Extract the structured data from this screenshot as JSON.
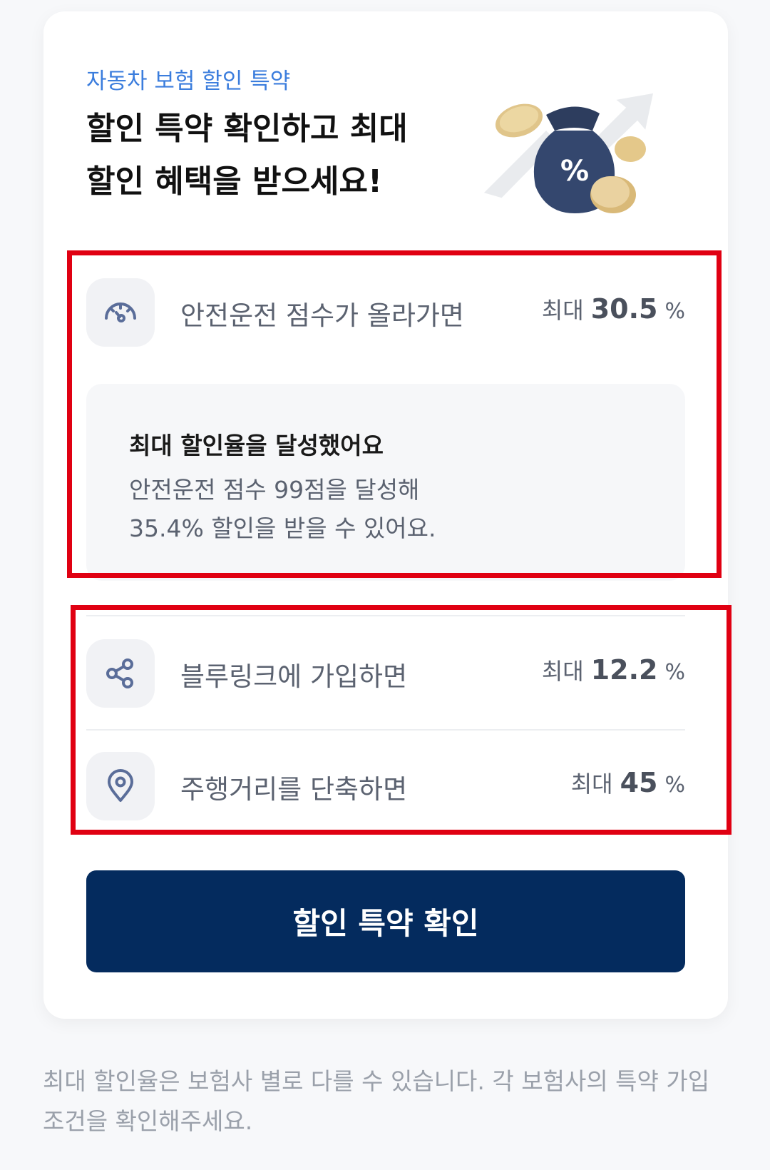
{
  "card": {
    "eyebrow": "자동차 보험 할인 특약",
    "headline": "할인 특약 확인하고 최대 할인 혜택을 받으세요!",
    "illustration_percent": "%"
  },
  "discounts": [
    {
      "icon": "speedometer-icon",
      "label": "안전운전 점수가 올라가면",
      "prefix": "최대",
      "value": "30.5",
      "unit": "%"
    },
    {
      "icon": "share-icon",
      "label": "블루링크에 가입하면",
      "prefix": "최대",
      "value": "12.2",
      "unit": "%"
    },
    {
      "icon": "location-pin-icon",
      "label": "주행거리를 단축하면",
      "prefix": "최대",
      "value": "45",
      "unit": "%"
    }
  ],
  "notice": {
    "title": "최대 할인율을 달성했어요",
    "line1": "안전운전 점수 99점을 달성해",
    "line2": "35.4% 할인을 받을 수 있어요."
  },
  "cta": {
    "label": "할인 특약 확인"
  },
  "footnote": "최대 할인율은 보험사 별로 다를 수 있습니다. 각 보험사의 특약 가입 조건을 확인해주세요.",
  "colors": {
    "accent_blue": "#3b7ddd",
    "cta_navy": "#042b5e",
    "highlight_red": "#e00012",
    "icon_color": "#5a6d99"
  }
}
